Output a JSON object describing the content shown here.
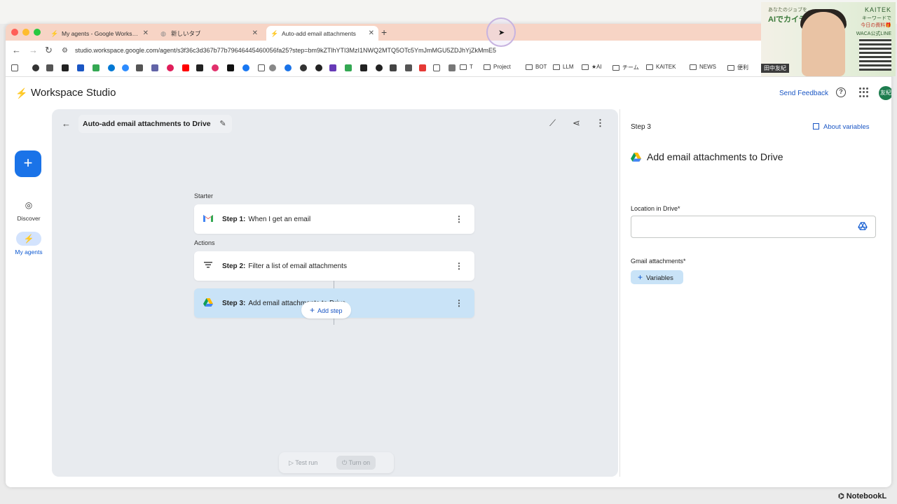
{
  "browser": {
    "tabs": [
      {
        "label": "My agents - Google Workspa"
      },
      {
        "label": "新しいタブ"
      },
      {
        "label": "Auto-add email attachments"
      }
    ],
    "url": "studio.workspace.google.com/agent/s3f36c3d367b77b79646445460056fa25?step=bm9kZTlhYTI3MzI1NWQ2MTQ5OTc5YmJmMGU5ZDJhYjZkMmE5",
    "bookmarks": [
      {
        "label": "T"
      },
      {
        "label": "Project"
      },
      {
        "label": "BOT"
      },
      {
        "label": "LLM"
      },
      {
        "label": "★AI"
      },
      {
        "label": "チーム"
      },
      {
        "label": "KAITEK"
      },
      {
        "label": "NEWS"
      },
      {
        "label": "便利"
      }
    ]
  },
  "app": {
    "title": "Workspace Studio",
    "send_feedback": "Send Feedback",
    "avatar_text": "友紀",
    "nav": [
      {
        "label": "Discover"
      },
      {
        "label": "My agents"
      }
    ]
  },
  "agent": {
    "title": "Auto-add email attachments to Drive",
    "starter_label": "Starter",
    "actions_label": "Actions",
    "steps": [
      {
        "num": "Step 1:",
        "text": "When I get an email",
        "icon": "gmail-icon"
      },
      {
        "num": "Step 2:",
        "text": "Filter a list of email attachments",
        "icon": "filter-icon"
      },
      {
        "num": "Step 3:",
        "text": "Add email attachments to Drive",
        "icon": "drive-icon"
      }
    ],
    "add_step": "Add step",
    "test_run": "Test run",
    "turn_on": "Turn on"
  },
  "panel": {
    "step_label": "Step 3",
    "about_variables": "About variables",
    "title": "Add email attachments to Drive",
    "location_label": "Location in Drive*",
    "location_value": "",
    "attachments_label": "Gmail attachments*",
    "variables_button": "Variables"
  },
  "overlay": {
    "webcam_line1": "あなたのジョブを",
    "webcam_line2": "AIでカイテキに",
    "webcam_right1": "KAITEK",
    "webcam_right2": "キーワードで",
    "webcam_right3": "今日の資料🎁",
    "webcam_right4": "WACA公式LINE",
    "webcam_name": "田中友紀",
    "notebook": "NotebookL"
  },
  "colors": {
    "accent": "#1a73e8",
    "tab_strip": "#f7d4c5",
    "selected_step": "#c9e3f7",
    "canvas": "#e8ebef"
  }
}
